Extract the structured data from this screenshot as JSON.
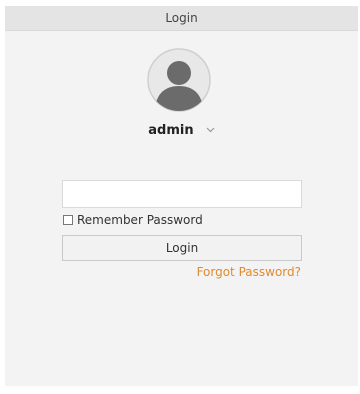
{
  "dialog": {
    "title": "Login"
  },
  "user": {
    "name": "admin",
    "avatar_icon": "user-avatar-icon",
    "dropdown_icon": "chevron-down-icon"
  },
  "form": {
    "password_value": "",
    "password_placeholder": "",
    "remember_label": "Remember Password",
    "remember_checked": false,
    "login_label": "Login",
    "forgot_label": "Forgot Password?"
  },
  "colors": {
    "accent": "#e08a2e",
    "background": "#f3f3f3",
    "titlebar": "#e4e4e4"
  }
}
